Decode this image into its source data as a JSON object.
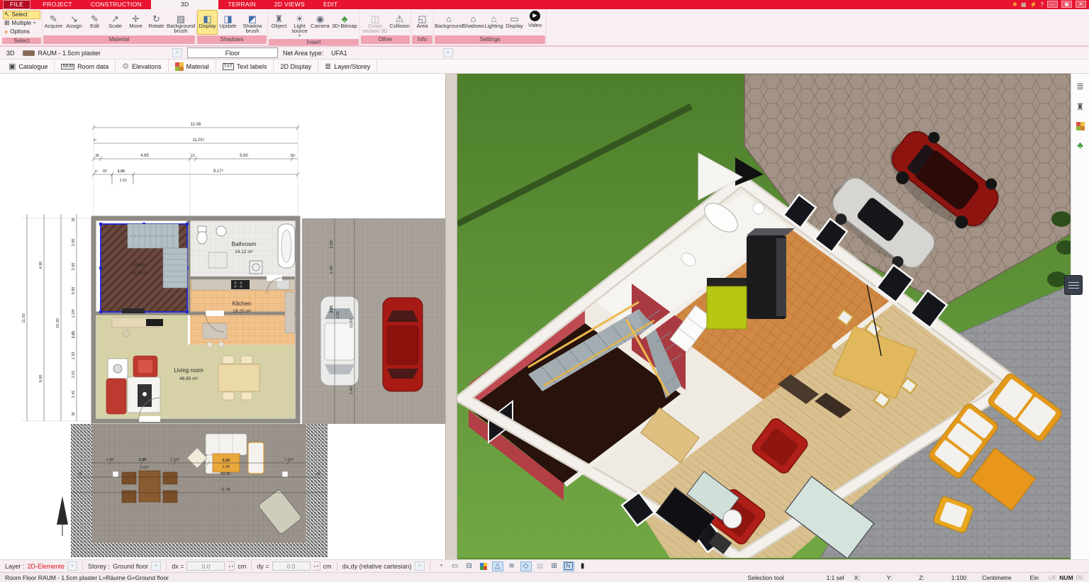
{
  "colors": {
    "accent": "#e8142f",
    "highlight": "#fde88e",
    "selection_blue": "#2026d8"
  },
  "tabs": [
    {
      "label": "FILE"
    },
    {
      "label": "PROJECT"
    },
    {
      "label": "CONSTRUCTION"
    },
    {
      "label": "3D"
    },
    {
      "label": "TERRAIN"
    },
    {
      "label": "2D VIEWS"
    },
    {
      "label": "EDIT"
    }
  ],
  "window": {
    "minimize": "–",
    "restore": "▣",
    "close": "✕"
  },
  "icons": {
    "select": "↖",
    "multiple": "⊞",
    "options": "+",
    "caret": "▾",
    "chev": "˅",
    "acquire": "✎",
    "assign": "↘",
    "edit": "✎",
    "scale": "↗",
    "move": "✛",
    "rotate": "↻",
    "background_brush": "▨",
    "display_cube": "◧",
    "update_cube": "◨",
    "shadow_brush": "◩",
    "object": "♜",
    "light": "☀",
    "camera": "◉",
    "bitmap3d": "♣",
    "cross_section": "◫",
    "collision": "⚠",
    "area": "◱",
    "house": "⌂",
    "monitor": "▭",
    "video": "▶",
    "catalogue": "▣",
    "roomdata": "▭",
    "gear": "⚙",
    "layers": "≣",
    "clock": "◔",
    "printer": "⊟",
    "polyline": "△",
    "multi": "≋",
    "diamond": "◇",
    "stack": "▤",
    "grid": "⊞",
    "bar": "▮",
    "sys1": "❖",
    "sys2": "▦",
    "sys3": "⚡",
    "sys4": "?",
    "sb_layers": "≣",
    "sb_chair": "♜",
    "sb_tree": "♣"
  },
  "ribbon": {
    "groups": [
      {
        "label": "Select",
        "buttons": [
          {
            "label": "Select"
          },
          {
            "label": "Multiple"
          },
          {
            "label": "Options"
          }
        ]
      },
      {
        "label": "Material",
        "buttons": [
          {
            "label": "Acquire"
          },
          {
            "label": "Assign"
          },
          {
            "label": "Edit"
          },
          {
            "label": "Scale"
          },
          {
            "label": "Move"
          },
          {
            "label": "Rotate"
          },
          {
            "label": "Background brush"
          }
        ]
      },
      {
        "label": "Shadows",
        "buttons": [
          {
            "label": "Display"
          },
          {
            "label": "Update"
          },
          {
            "label": "Shadow brush"
          }
        ]
      },
      {
        "label": "Insert",
        "buttons": [
          {
            "label": "Object"
          },
          {
            "label": "Light source"
          },
          {
            "label": "Camera"
          },
          {
            "label": "3D-Bitmap"
          }
        ]
      },
      {
        "label": "Other",
        "buttons": [
          {
            "label": "Cross section 3D"
          },
          {
            "label": "Collision"
          }
        ]
      },
      {
        "label": "Info",
        "buttons": [
          {
            "label": "Area"
          }
        ]
      },
      {
        "label": "Settings",
        "buttons": [
          {
            "label": "Background"
          },
          {
            "label": "Shadows"
          },
          {
            "label": "Lighting"
          },
          {
            "label": "Display"
          },
          {
            "label": "Video"
          }
        ]
      }
    ]
  },
  "room_toolbar": {
    "view": "3D",
    "material": "RAUM - 1.5cm plaster",
    "floor": "Floor",
    "net_area_label": "Net Area type:",
    "net_area_value": "UFA1"
  },
  "tools_toolbar": {
    "catalogue": "Catalogue",
    "room_data": "Room data",
    "room_badge": "RAUM",
    "elevations": "Elevations",
    "material": "Material",
    "txt_badge": "TXT",
    "text_labels": "Text labels",
    "display_2d": "2D Display",
    "layer_storey": "Layer/Storey"
  },
  "plan": {
    "rooms": [
      {
        "name": "Floor",
        "area": "18.14 m²"
      },
      {
        "name": "Bathroom",
        "area": "14.12 m²"
      },
      {
        "name": "Kitchen",
        "area": "19.20 m²"
      },
      {
        "name": "Living room",
        "area": "48.85 m²"
      }
    ],
    "dims_top": [
      "11.08",
      "11.01⁵",
      "6⁵",
      "36",
      "4.65",
      "10",
      "5.60",
      "36⁵",
      "5⁵",
      "83",
      "1.01",
      "1.51",
      "9.17⁵"
    ],
    "dims_left": [
      "11.03",
      "4.90",
      "10.30",
      "6.00",
      "36",
      "2.00",
      "2.50",
      "0.90",
      "1.24⁵",
      "1.01",
      "1.33",
      "1.51",
      "1.41",
      "36"
    ],
    "dims_right": [
      "2.58⁵",
      "1.26⁵",
      "2.01",
      "1.51",
      "11.03",
      "1.42⁵"
    ],
    "dims_terrace": [
      "1.65",
      "2.00",
      "2.63⁵",
      "1.10⁵",
      "5.00",
      "2.35",
      "1.32⁵",
      "36",
      "10.35",
      "36",
      "11.08"
    ]
  },
  "bottom_toolbar": {
    "layer_label": "Layer :",
    "layer_value": "2D-Elemente",
    "storey_label": "Storey :",
    "storey_value": "Ground floor",
    "dx_label": "dx =",
    "dx_value": "0.0",
    "dy_label": "dy =",
    "dy_value": "0.0",
    "unit_cm": "cm",
    "mode": "dx,dy (relative cartesian)",
    "n_badge": "N"
  },
  "status_bar": {
    "message": "Room Floor RAUM - 1.5cm plaster L=Räume G=Ground floor",
    "tool": "Selection tool",
    "sel": "1:1 sel",
    "x": "X:",
    "y": "Y:",
    "z": "Z:",
    "scale": "1:100",
    "unit": "Centimetre",
    "ein": "Ein",
    "uf": "UF",
    "num": "NUM",
    "rf": "RF"
  }
}
